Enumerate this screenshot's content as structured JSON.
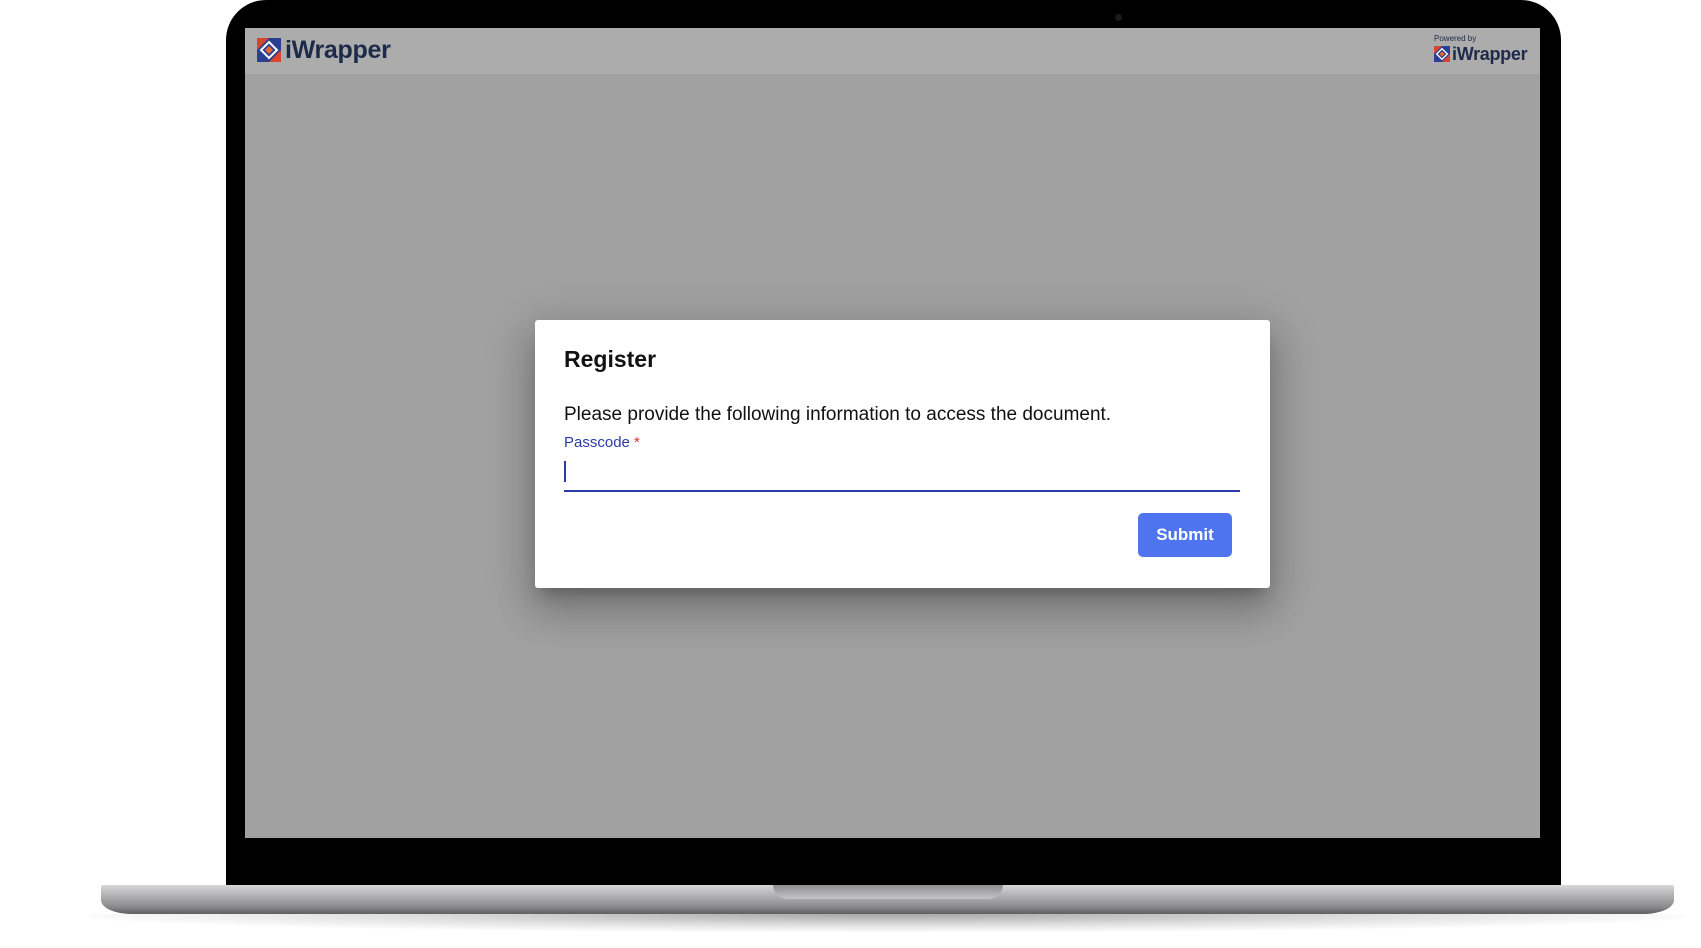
{
  "header": {
    "brand_name": "iWrapper",
    "powered_by_label": "Powered by",
    "powered_by_brand": "iWrapper"
  },
  "dialog": {
    "title": "Register",
    "message": "Please provide the following information to access the document.",
    "passcode_label": "Passcode",
    "required_marker": "*",
    "passcode_value": "",
    "submit_label": "Submit"
  },
  "colors": {
    "accent": "#2b3aa6",
    "submit_button": "#4f74ef",
    "required": "#e0303a",
    "backdrop": "#a1a1a1",
    "brand_text": "#1e2a4a"
  },
  "icons": {
    "brand_logo": "iwrapper-logo-icon",
    "powered_logo": "iwrapper-logo-icon"
  }
}
